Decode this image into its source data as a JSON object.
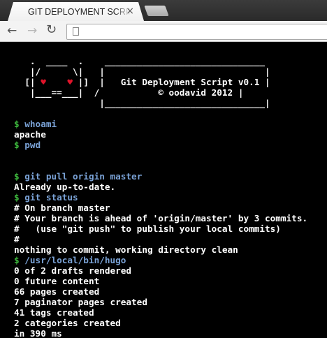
{
  "tab": {
    "title": "GIT DEPLOYMENT SCRIPT",
    "close": "×"
  },
  "toolbar": {
    "back": "←",
    "forward": "→",
    "reload": "↻",
    "url": ""
  },
  "banner": {
    "row1": "   .  ____  .    ______________________________",
    "row2a": "   |/      \\|   |                              |",
    "row3a": "  [| ",
    "heart": "♥",
    "row3b": "    ",
    "row3c": " |]  |   Git Deployment Script v0.1 |",
    "row4": "   |___==___|  /           © oodavid 2012 |",
    "row5": "                |______________________________|"
  },
  "terminal": {
    "prompt": "$",
    "lines": [
      {
        "type": "cmd",
        "text": "whoami"
      },
      {
        "type": "out",
        "text": "apache"
      },
      {
        "type": "cmd",
        "text": "pwd"
      },
      {
        "type": "blank",
        "text": ""
      },
      {
        "type": "blank",
        "text": ""
      },
      {
        "type": "cmd",
        "text": "git pull origin master"
      },
      {
        "type": "out",
        "text": "Already up-to-date."
      },
      {
        "type": "cmd",
        "text": "git status"
      },
      {
        "type": "out",
        "text": "# On branch master"
      },
      {
        "type": "out",
        "text": "# Your branch is ahead of 'origin/master' by 3 commits."
      },
      {
        "type": "out",
        "text": "#   (use \"git push\" to publish your local commits)"
      },
      {
        "type": "out",
        "text": "#"
      },
      {
        "type": "out",
        "text": "nothing to commit, working directory clean"
      },
      {
        "type": "cmd",
        "text": "/usr/local/bin/hugo"
      },
      {
        "type": "out",
        "text": "0 of 2 drafts rendered"
      },
      {
        "type": "out",
        "text": "0 future content"
      },
      {
        "type": "out",
        "text": "66 pages created"
      },
      {
        "type": "out",
        "text": "7 paginator pages created"
      },
      {
        "type": "out",
        "text": "41 tags created"
      },
      {
        "type": "out",
        "text": "2 categories created"
      },
      {
        "type": "out",
        "text": "in 390 ms"
      }
    ]
  }
}
